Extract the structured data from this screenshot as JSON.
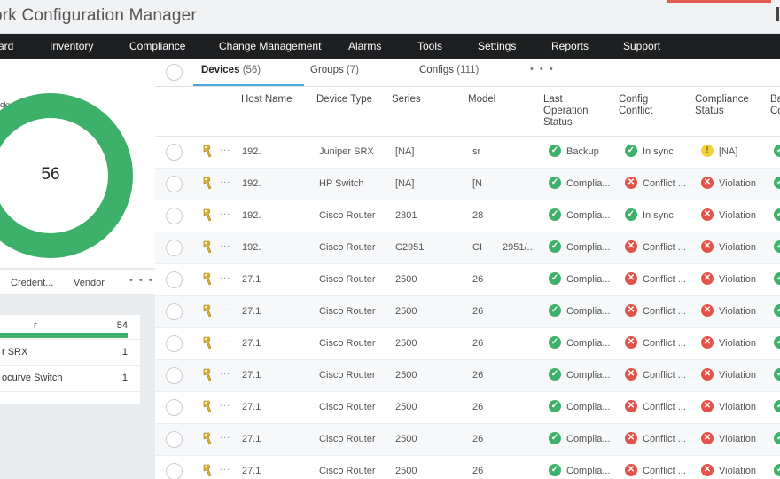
{
  "app": {
    "title": "ork Configuration Manager"
  },
  "nav": {
    "items": [
      {
        "id": "dashboard",
        "label": "ard"
      },
      {
        "id": "inventory",
        "label": "Inventory"
      },
      {
        "id": "compliance",
        "label": "Compliance"
      },
      {
        "id": "change-management",
        "label": "Change Management"
      },
      {
        "id": "alarms",
        "label": "Alarms"
      },
      {
        "id": "tools",
        "label": "Tools"
      },
      {
        "id": "settings",
        "label": "Settings"
      },
      {
        "id": "reports",
        "label": "Reports"
      },
      {
        "id": "support",
        "label": "Support"
      }
    ]
  },
  "left": {
    "donut": {
      "label": "ckup Success",
      "value": "56",
      "fraction": 1.0,
      "color": "#3db16a"
    },
    "tabs": {
      "credentials": "Credent...",
      "vendor": "Vendor",
      "more": "• • •"
    },
    "list": [
      {
        "name": "r",
        "count": "54"
      },
      {
        "name": "r SRX",
        "count": "1"
      },
      {
        "name": "ocurve Switch",
        "count": "1"
      }
    ]
  },
  "tabs": {
    "devices": {
      "label": "Devices",
      "count": "(56)"
    },
    "groups": {
      "label": "Groups",
      "count": "(7)"
    },
    "configs": {
      "label": "Configs",
      "count": "(111)"
    },
    "more": "• • •"
  },
  "table": {
    "headers": {
      "host": "Host Name",
      "type": "Device Type",
      "series": "Series",
      "model": "Model",
      "lastop": "Last Operation Status",
      "conflict": "Config Conflict",
      "compliance": "Compliance Status",
      "backup": "Ba Co"
    },
    "rows": [
      {
        "host": "192.",
        "type": "Juniper SRX",
        "series": "[NA]",
        "model": "sr",
        "extra": "",
        "op": "Backup",
        "op_s": "ok",
        "cc": "In sync",
        "cc_s": "ok",
        "cs": "[NA]",
        "cs_s": "warn"
      },
      {
        "host": "192.",
        "type": "HP Switch",
        "series": "[NA]",
        "model": "[N",
        "extra": "",
        "op": "Complia...",
        "op_s": "ok",
        "cc": "Conflict ...",
        "cc_s": "bad",
        "cs": "Violation",
        "cs_s": "bad"
      },
      {
        "host": "192.",
        "type": "Cisco Router",
        "series": "2801",
        "model": "28",
        "extra": "",
        "op": "Complia...",
        "op_s": "ok",
        "cc": "In sync",
        "cc_s": "ok",
        "cs": "Violation",
        "cs_s": "bad"
      },
      {
        "host": "192.",
        "type": "Cisco Router",
        "series": "C2951",
        "model": "CI",
        "extra": "2951/...",
        "op": "Complia...",
        "op_s": "ok",
        "cc": "Conflict ...",
        "cc_s": "bad",
        "cs": "Violation",
        "cs_s": "bad"
      },
      {
        "host": "27.1",
        "type": "Cisco Router",
        "series": "2500",
        "model": "26",
        "extra": "",
        "op": "Complia...",
        "op_s": "ok",
        "cc": "Conflict ...",
        "cc_s": "bad",
        "cs": "Violation",
        "cs_s": "bad"
      },
      {
        "host": "27.1",
        "type": "Cisco Router",
        "series": "2500",
        "model": "26",
        "extra": "",
        "op": "Complia...",
        "op_s": "ok",
        "cc": "Conflict ...",
        "cc_s": "bad",
        "cs": "Violation",
        "cs_s": "bad"
      },
      {
        "host": "27.1",
        "type": "Cisco Router",
        "series": "2500",
        "model": "26",
        "extra": "",
        "op": "Complia...",
        "op_s": "ok",
        "cc": "Conflict ...",
        "cc_s": "bad",
        "cs": "Violation",
        "cs_s": "bad"
      },
      {
        "host": "27.1",
        "type": "Cisco Router",
        "series": "2500",
        "model": "26",
        "extra": "",
        "op": "Complia...",
        "op_s": "ok",
        "cc": "Conflict ...",
        "cc_s": "bad",
        "cs": "Violation",
        "cs_s": "bad"
      },
      {
        "host": "27.1",
        "type": "Cisco Router",
        "series": "2500",
        "model": "26",
        "extra": "",
        "op": "Complia...",
        "op_s": "ok",
        "cc": "Conflict ...",
        "cc_s": "bad",
        "cs": "Violation",
        "cs_s": "bad"
      },
      {
        "host": "27.1",
        "type": "Cisco Router",
        "series": "2500",
        "model": "26",
        "extra": "",
        "op": "Complia...",
        "op_s": "ok",
        "cc": "Conflict ...",
        "cc_s": "bad",
        "cs": "Violation",
        "cs_s": "bad"
      },
      {
        "host": "27.1",
        "type": "Cisco Router",
        "series": "2500",
        "model": "26",
        "extra": "",
        "op": "Complia...",
        "op_s": "ok",
        "cc": "Conflict ...",
        "cc_s": "bad",
        "cs": "Violation",
        "cs_s": "bad"
      }
    ]
  },
  "colors": {
    "ok": "#3db16a",
    "bad": "#e2534a",
    "warn": "#f2d23c",
    "accent": "#45a9d8",
    "nav": "#1e1f21"
  }
}
